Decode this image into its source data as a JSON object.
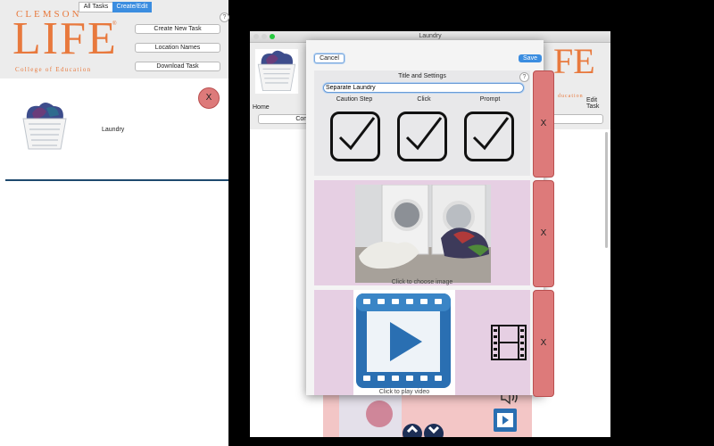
{
  "left_app": {
    "segments": {
      "all_tasks": "All Tasks",
      "create_edit": "Create/Edit"
    },
    "logo": {
      "top": "CLEMSON",
      "main": "LIFE",
      "tm": "®",
      "sub": "College of Education"
    },
    "buttons": {
      "create_new_task": "Create New Task",
      "location_names": "Location Names",
      "download_task": "Download Task"
    },
    "help": "?",
    "task": {
      "name": "Laundry",
      "delete": "X"
    }
  },
  "window": {
    "title": "Laundry",
    "behind": {
      "home": "Home",
      "comb_partial": "Comb",
      "edit_task": "Edit Task",
      "logo_partial": "FE",
      "logo_sub_partial": "ducation"
    }
  },
  "dialog": {
    "cancel": "Cancel",
    "save": "Save",
    "help": "?",
    "section_title": "Title and Settings",
    "title_value": "Separate Laundry",
    "settings": [
      {
        "label": "Caution Step",
        "checked": true
      },
      {
        "label": "Click",
        "checked": true
      },
      {
        "label": "Prompt",
        "checked": true
      }
    ],
    "image_caption": "Click to choose image",
    "video_caption": "Click to play video",
    "delete": "X"
  },
  "colors": {
    "accent": "#3b8de0",
    "delete_red": "#dd7a7a",
    "pink_panel": "#e6cfe3",
    "logo_orange": "#e8793d",
    "divider_blue": "#1e4a6e"
  }
}
